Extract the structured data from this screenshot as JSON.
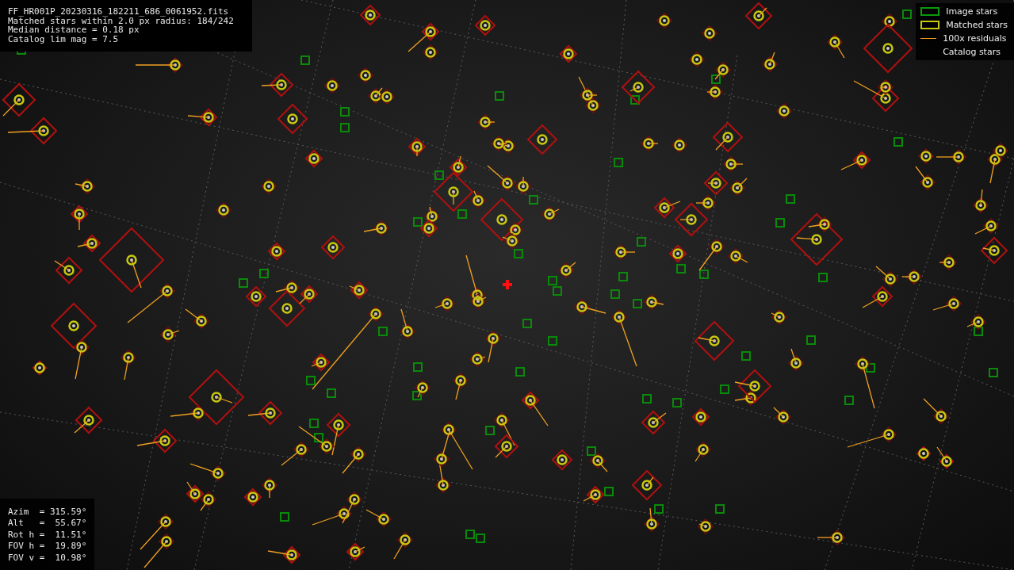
{
  "header": {
    "lines": [
      "FF_HR001P_20230316_182211_686_0061952.fits",
      "Matched stars within 2.0 px radius: 184/242",
      "Median distance = 0.18 px",
      "Catalog lim mag = 7.5"
    ]
  },
  "legend": [
    {
      "kind": "image",
      "label": "Image stars"
    },
    {
      "kind": "matched",
      "label": "Matched stars"
    },
    {
      "kind": "residual",
      "label": "100x residuals"
    },
    {
      "kind": "catalog",
      "label": "Catalog stars"
    }
  ],
  "pointing": {
    "lines": [
      "Azim  = 315.59°",
      "Alt   =  55.67°",
      "Rot h =  11.51°",
      "FOV h =  19.89°",
      "FOV v =  10.98°"
    ]
  }
}
